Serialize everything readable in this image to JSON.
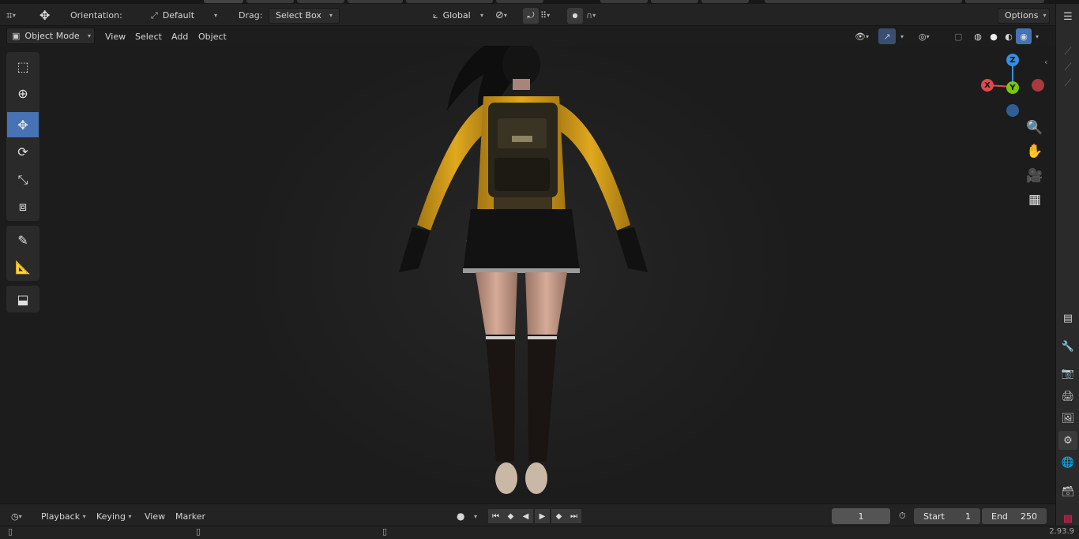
{
  "header": {
    "orientation_label": "Orientation:",
    "orientation_value": "Default",
    "drag_label": "Drag:",
    "drag_value": "Select Box",
    "transform_orientation": "Global",
    "options_label": "Options"
  },
  "viewport_header": {
    "mode": "Object Mode",
    "menus": [
      "View",
      "Select",
      "Add",
      "Object"
    ]
  },
  "gizmo": {
    "x_label": "X",
    "y_label": "Y",
    "z_label": "Z",
    "colors": {
      "x": "#e0484f",
      "y": "#7ac70c",
      "z": "#3a8ee0",
      "neg_x": "#a83a40",
      "neg_z": "#2f5f94"
    }
  },
  "timeline": {
    "menus": [
      "Playback",
      "Keying",
      "View",
      "Marker"
    ],
    "current_frame": "1",
    "start_label": "Start",
    "start_value": "1",
    "end_label": "End",
    "end_value": "250"
  },
  "status": {
    "version": "2.93.9"
  },
  "icons": {
    "select_box": "select-box-icon",
    "cursor": "cursor-icon",
    "move": "move-icon",
    "rotate": "rotate-icon",
    "scale": "scale-icon",
    "transform": "transform-icon",
    "annotate": "annotate-icon",
    "measure": "measure-icon",
    "add_cube": "add-cube-icon"
  },
  "accent_color": "#4772b3",
  "character_colors": {
    "jacket": "#d8a11c",
    "skirt": "#141414",
    "stockings": "#1a1412",
    "skin": "#c9a08e",
    "hair": "#111111"
  }
}
